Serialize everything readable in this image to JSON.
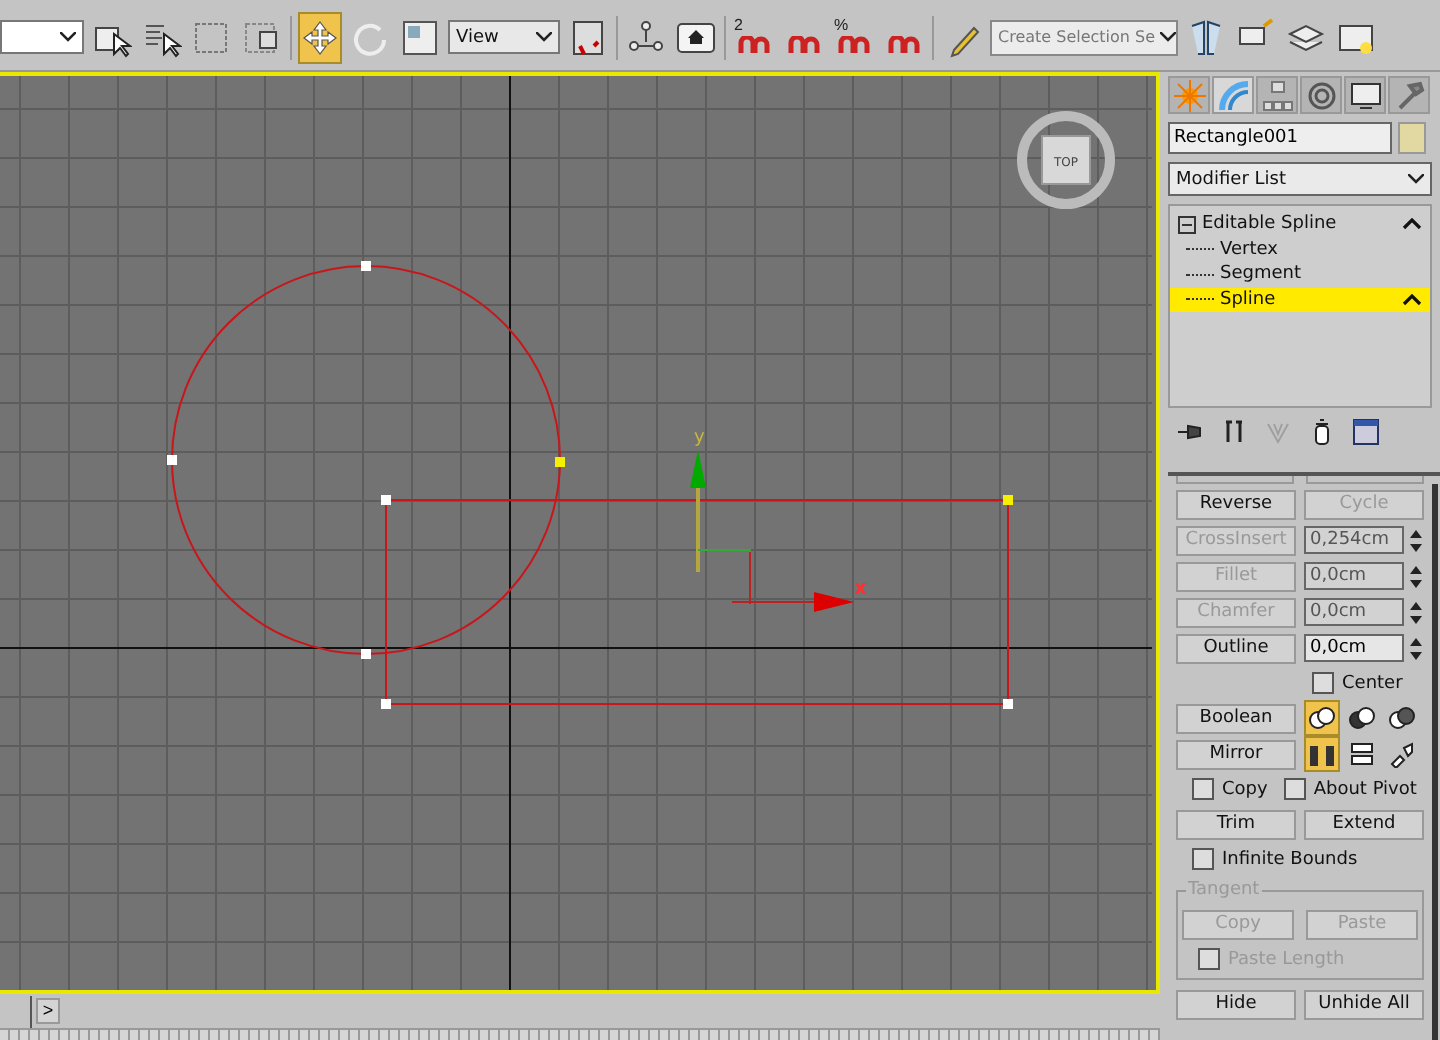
{
  "toolbar": {
    "items": [
      {
        "kind": "dropdown",
        "value": ""
      },
      {
        "kind": "select",
        "selected": false
      },
      {
        "kind": "select-by-name",
        "selected": false
      },
      {
        "kind": "region",
        "selected": false
      },
      {
        "kind": "window-crossing",
        "selected": false
      },
      {
        "kind": "move",
        "selected": true
      },
      {
        "kind": "rotate",
        "selected": false
      },
      {
        "kind": "scale",
        "selected": false
      },
      {
        "kind": "dropdown",
        "value": "View"
      },
      {
        "kind": "pivot",
        "selected": false
      },
      {
        "kind": "link",
        "selected": false
      },
      {
        "kind": "shortcut",
        "selected": false
      },
      {
        "kind": "snap",
        "label": "2",
        "selected": false
      },
      {
        "kind": "angle-snap",
        "selected": false
      },
      {
        "kind": "percent-snap",
        "label": "%",
        "selected": false
      },
      {
        "kind": "spinner-snap",
        "selected": false
      },
      {
        "kind": "named-sets",
        "selected": false
      },
      {
        "kind": "combo",
        "placeholder": "Create Selection Se"
      },
      {
        "kind": "mirror",
        "selected": false
      },
      {
        "kind": "align",
        "selected": false
      },
      {
        "kind": "layers",
        "selected": false
      },
      {
        "kind": "explorer",
        "selected": false
      }
    ]
  },
  "viewport": {
    "viewcube": "TOP",
    "axis_x": "x",
    "axis_y": "y"
  },
  "command_panel": {
    "tabs": [
      {
        "kind": "create",
        "selected": false
      },
      {
        "kind": "modify",
        "selected": true
      },
      {
        "kind": "hierarchy",
        "selected": false
      },
      {
        "kind": "motion",
        "selected": false
      },
      {
        "kind": "display",
        "selected": false
      },
      {
        "kind": "utilities",
        "selected": false
      }
    ],
    "object": {
      "name": "Rectangle001",
      "color": "#e2d8a2"
    },
    "modifier_list": "Modifier List",
    "stack": [
      {
        "label": "Editable Spline",
        "selected": false,
        "expanded": true,
        "children": [
          {
            "label": "Vertex",
            "selected": false
          },
          {
            "label": "Segment",
            "selected": false
          },
          {
            "label": "Spline",
            "selected": true
          }
        ]
      }
    ],
    "stack_tools": [
      {
        "kind": "pin",
        "disabled": false
      },
      {
        "kind": "show-result",
        "disabled": false
      },
      {
        "kind": "make-unique",
        "disabled": true
      },
      {
        "kind": "remove",
        "disabled": false
      },
      {
        "kind": "configure",
        "disabled": false
      }
    ],
    "rollout": [
      {
        "kind": "pair",
        "buttons": [
          {
            "label": "Reverse",
            "disabled": false
          },
          {
            "label": "Cycle",
            "disabled": true
          }
        ]
      },
      {
        "kind": "spinner",
        "label": "CrossInsert",
        "value": "0,254cm",
        "disabled": true
      },
      {
        "kind": "spinner",
        "label": "Fillet",
        "value": "0,0cm",
        "disabled": true
      },
      {
        "kind": "spinner",
        "label": "Chamfer",
        "value": "0,0cm",
        "disabled": true
      },
      {
        "kind": "spinner",
        "label": "Outline",
        "value": "0,0cm",
        "disabled": false
      },
      {
        "kind": "checkbox",
        "label": "Center",
        "checked": false
      },
      {
        "kind": "icons",
        "label": "Boolean",
        "icons": [
          {
            "kind": "union",
            "selected": true
          },
          {
            "kind": "subtract",
            "selected": false
          },
          {
            "kind": "intersect",
            "selected": false
          }
        ]
      },
      {
        "kind": "icons",
        "label": "Mirror",
        "icons": [
          {
            "kind": "mirror-h",
            "selected": true
          },
          {
            "kind": "mirror-v",
            "selected": false
          },
          {
            "kind": "mirror-both",
            "selected": false
          }
        ]
      },
      {
        "kind": "checkboxes",
        "items": [
          {
            "label": "Copy",
            "checked": false
          },
          {
            "label": "About Pivot",
            "checked": false
          }
        ]
      },
      {
        "kind": "pair",
        "buttons": [
          {
            "label": "Trim",
            "disabled": false
          },
          {
            "label": "Extend",
            "disabled": false
          }
        ]
      },
      {
        "kind": "checkbox",
        "label": "Infinite Bounds",
        "checked": false
      },
      {
        "kind": "group",
        "title": "Tangent",
        "disabled": true,
        "buttons": [
          {
            "label": "Copy",
            "disabled": true
          },
          {
            "label": "Paste",
            "disabled": true
          }
        ],
        "checkbox": {
          "label": "Paste Length",
          "checked": false
        }
      },
      {
        "kind": "pair",
        "buttons": [
          {
            "label": "Hide",
            "disabled": false
          },
          {
            "label": "Unhide All",
            "disabled": false
          }
        ]
      }
    ]
  },
  "timeline": {
    "next_button": ">"
  }
}
